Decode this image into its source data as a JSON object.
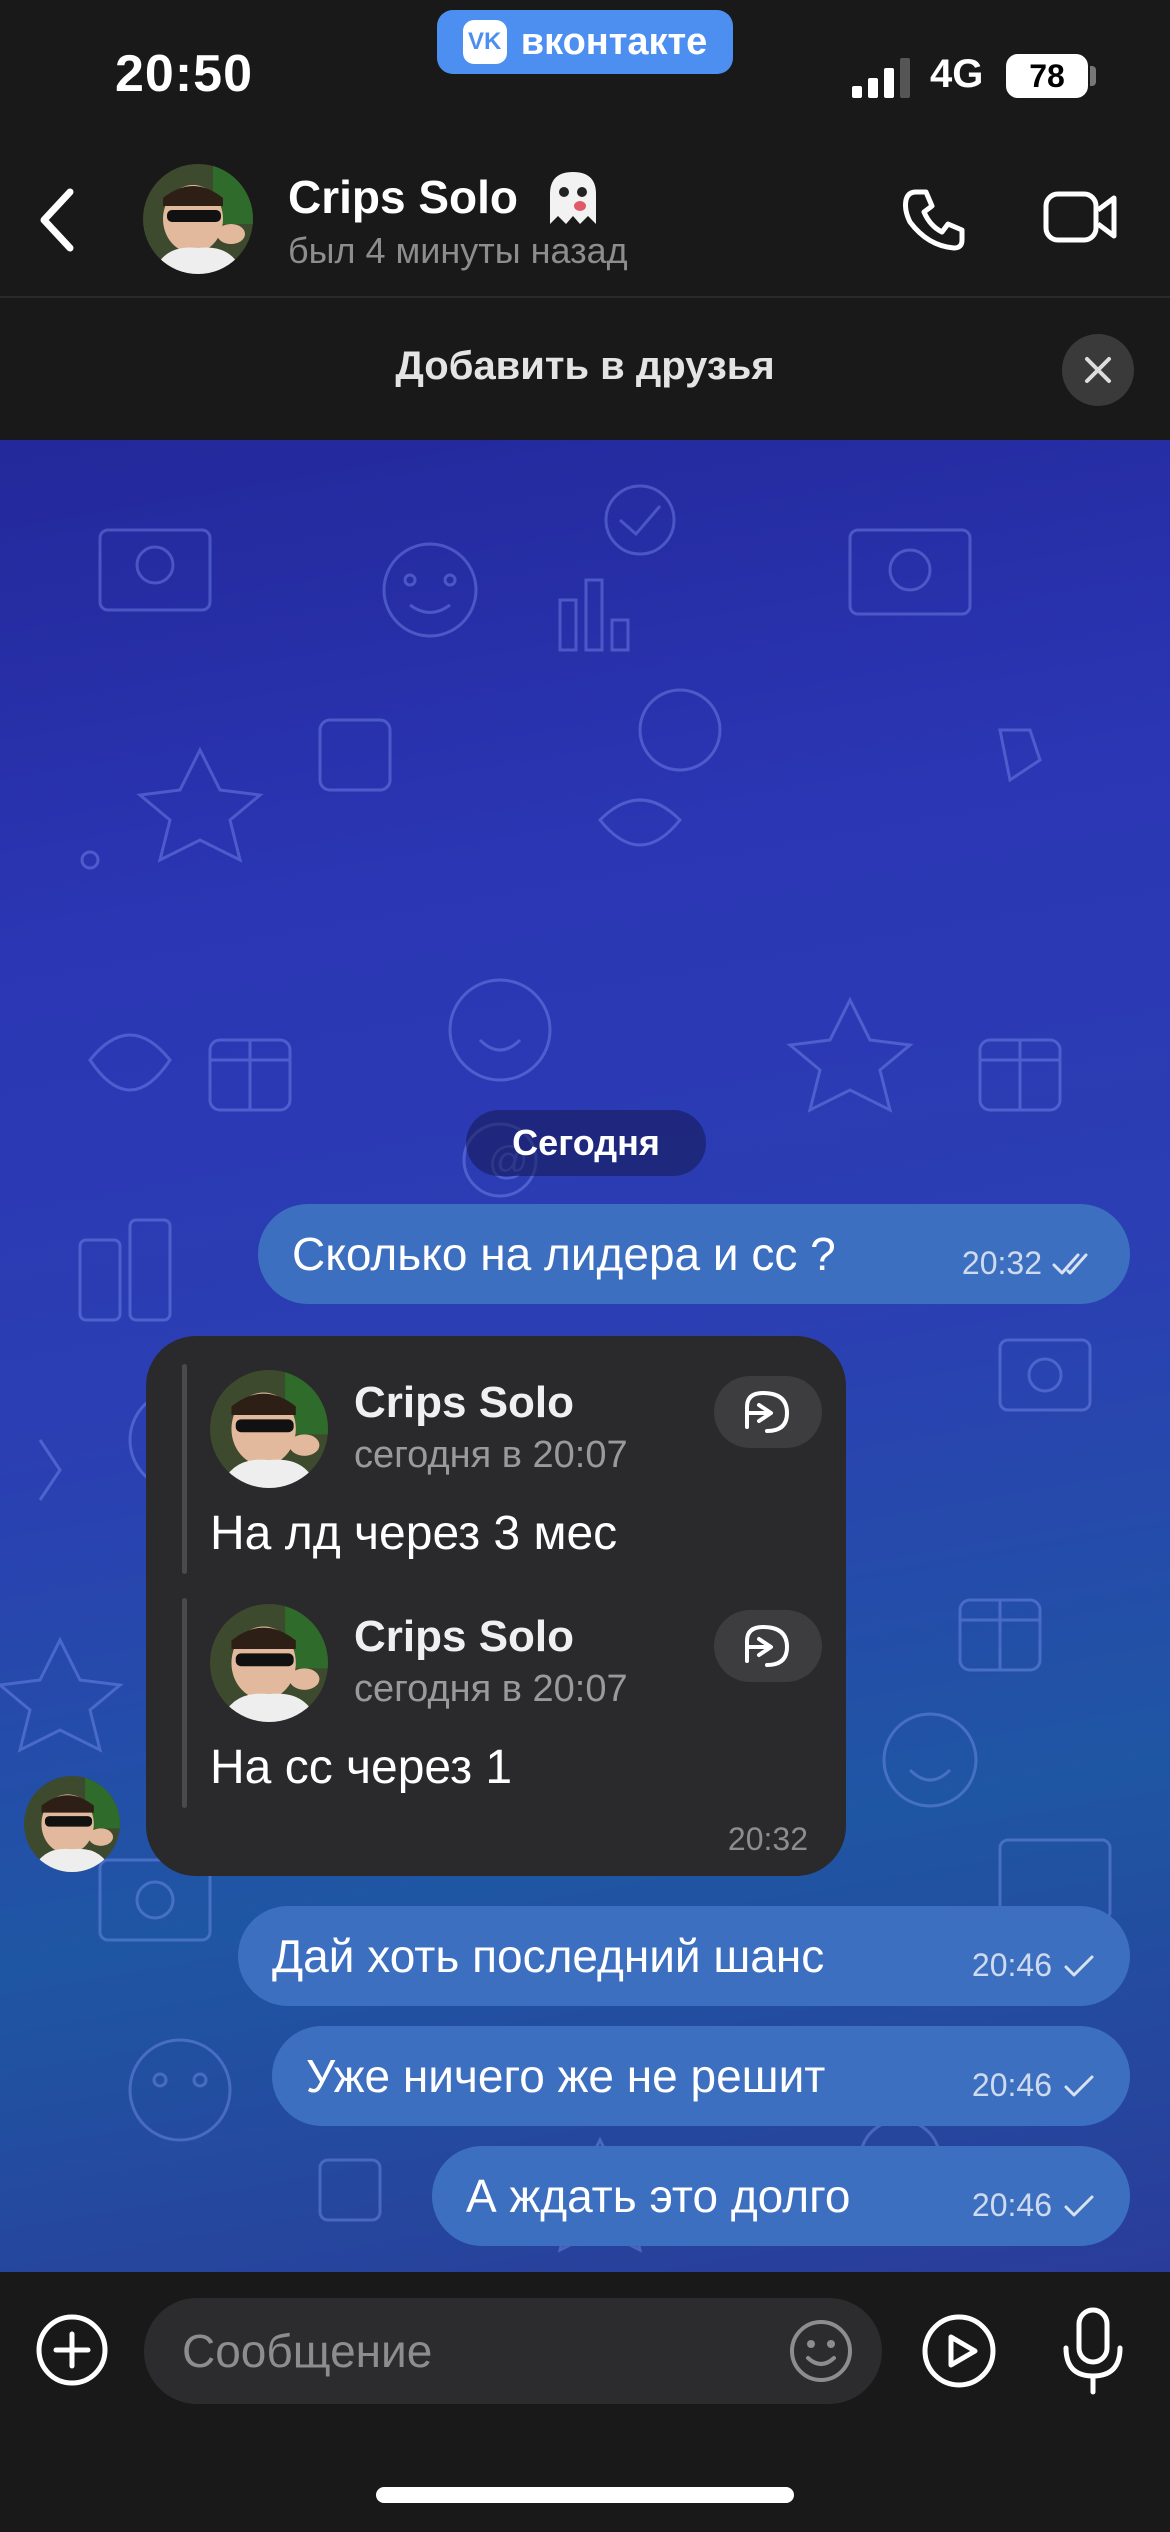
{
  "status_bar": {
    "time": "20:50",
    "app_badge": "вконтакте",
    "network": "4G",
    "battery": "78"
  },
  "header": {
    "contact_name": "Crips Solo",
    "contact_status": "был 4 минуты назад"
  },
  "add_friend": {
    "label": "Добавить в друзья"
  },
  "chat": {
    "date_separator": "Сегодня",
    "messages": [
      {
        "text": "Сколько на лидера и сс ?",
        "time": "20:32",
        "status": "read"
      },
      {
        "forwarded": [
          {
            "author": "Crips Solo",
            "date": "сегодня в 20:07",
            "text": "На лд через 3 мес"
          },
          {
            "author": "Crips Solo",
            "date": "сегодня в 20:07",
            "text": "На сс через 1"
          }
        ],
        "time": "20:32"
      },
      {
        "text": "Дай хоть последний шанс",
        "time": "20:46",
        "status": "sent"
      },
      {
        "text": "Уже ничего же не решит",
        "time": "20:46",
        "status": "sent"
      },
      {
        "text": "А ждать это долго",
        "time": "20:46",
        "status": "sent"
      }
    ]
  },
  "composer": {
    "placeholder": "Сообщение"
  },
  "colors": {
    "outgoing_bubble": "#3d6fc0",
    "forward_card": "#2a2a2c",
    "vk_blue": "#4d8ff0",
    "background": "#191919"
  },
  "icons": [
    "back-icon",
    "phone-icon",
    "video-camera-icon",
    "close-icon",
    "reply-forward-icon",
    "plus-icon",
    "emoji-icon",
    "play-icon",
    "microphone-icon",
    "double-check-icon",
    "check-icon"
  ]
}
